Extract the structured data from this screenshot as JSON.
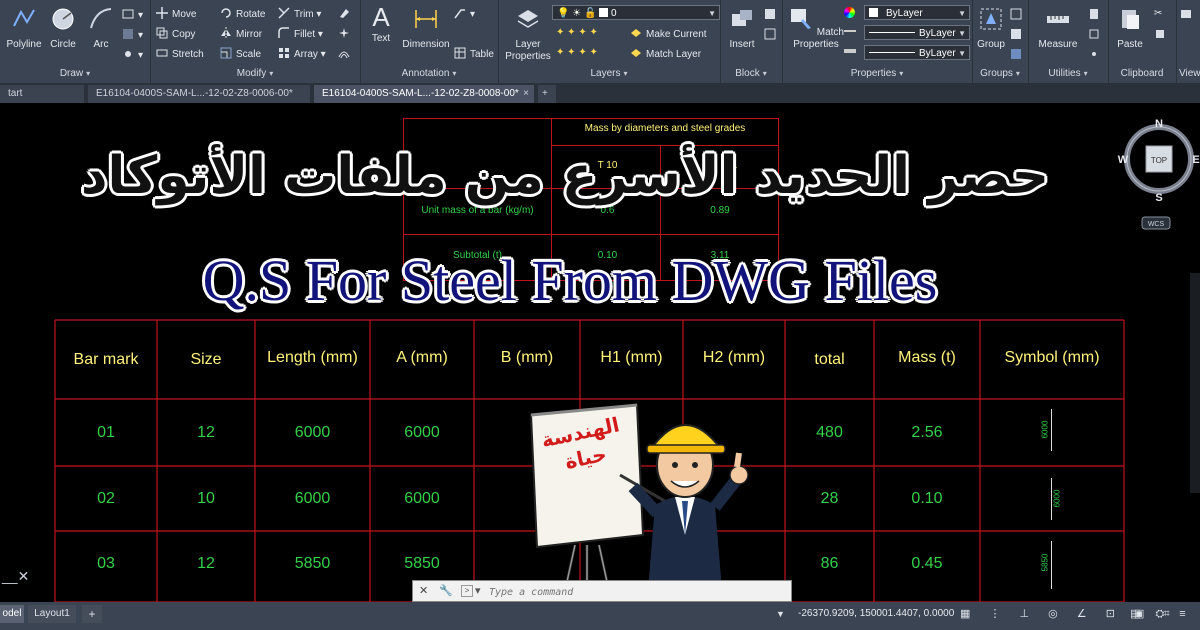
{
  "ribbon": {
    "draw": {
      "title": "Draw",
      "polyline": "Polyline",
      "circle": "Circle",
      "arc": "Arc"
    },
    "modify": {
      "title": "Modify",
      "move": "Move",
      "rotate": "Rotate",
      "trim": "Trim",
      "copy": "Copy",
      "mirror": "Mirror",
      "fillet": "Fillet",
      "stretch": "Stretch",
      "scale": "Scale",
      "array": "Array"
    },
    "annotation": {
      "title": "Annotation",
      "text": "Text",
      "dimension": "Dimension",
      "table": "Table"
    },
    "layers": {
      "title": "Layers",
      "layer_properties": "Layer\nProperties",
      "current_layer": "0",
      "make_current": "Make Current",
      "match_layer": "Match Layer"
    },
    "block": {
      "title": "Block",
      "insert": "Insert"
    },
    "properties": {
      "title": "Properties",
      "match_properties": "Match\nProperties",
      "color": "ByLayer",
      "linetype": "ByLayer",
      "lineweight": "ByLayer"
    },
    "groups": {
      "title": "Groups",
      "group": "Group"
    },
    "utilities": {
      "title": "Utilities",
      "measure": "Measure"
    },
    "clipboard": {
      "title": "Clipboard",
      "paste": "Paste"
    },
    "view": {
      "title": "View"
    }
  },
  "file_tabs": [
    {
      "label": "tart",
      "active": false
    },
    {
      "label": "E16104-0400S-SAM-L...-12-02-Z8-0006-00*",
      "active": false
    },
    {
      "label": "E16104-0400S-SAM-L...-12-02-Z8-0008-00*",
      "active": true
    }
  ],
  "overlay": {
    "arabic_title": "حصر الحديد الأسرع من ملفات الأتوكاد",
    "english_title": "Q.S For Steel From DWG Files",
    "logo_text": "الهندسة حياة"
  },
  "upper_table": {
    "header": "Mass by diameters and steel grades",
    "col": "T 10",
    "col2": "T 1",
    "row1_label": "Unit mass of a bar (kg/m)",
    "row1_v1": "0.89",
    "row1_v0": "0.6",
    "row2_label": "Subtotal (t)",
    "row2_v0": "0.10",
    "row2_v1": "3.11"
  },
  "schedule": {
    "headers": [
      "Bar mark",
      "Size",
      "Length (mm)",
      "A (mm)",
      "B (mm)",
      "H1 (mm)",
      "H2 (mm)",
      "total",
      "Mass (t)",
      "Symbol (mm)"
    ],
    "rows": [
      {
        "mark": "01",
        "size": "12",
        "length": "6000",
        "a": "6000",
        "total": "480",
        "mass": "2.56",
        "symbol": "6000"
      },
      {
        "mark": "02",
        "size": "10",
        "length": "6000",
        "a": "6000",
        "total": "28",
        "mass": "0.10",
        "symbol": "6000"
      },
      {
        "mark": "03",
        "size": "12",
        "length": "5850",
        "a": "5850",
        "total": "86",
        "mass": "0.45",
        "symbol": "5850"
      }
    ]
  },
  "viewcube": {
    "n": "N",
    "s": "S",
    "e": "E",
    "w": "W",
    "top": "TOP",
    "wcs": "WCS"
  },
  "command": {
    "placeholder": "Type a command"
  },
  "status": {
    "model_tab": "odel",
    "layout_tab": "Layout1",
    "add_tab": "+",
    "coordinates": "-26370.9209, 150001.4407, 0.0000"
  },
  "colors": {
    "grid_red": "#c1121f",
    "header_yellow": "#fff27a",
    "value_green": "#33d14a",
    "ribbon_bg": "#3b4453"
  }
}
